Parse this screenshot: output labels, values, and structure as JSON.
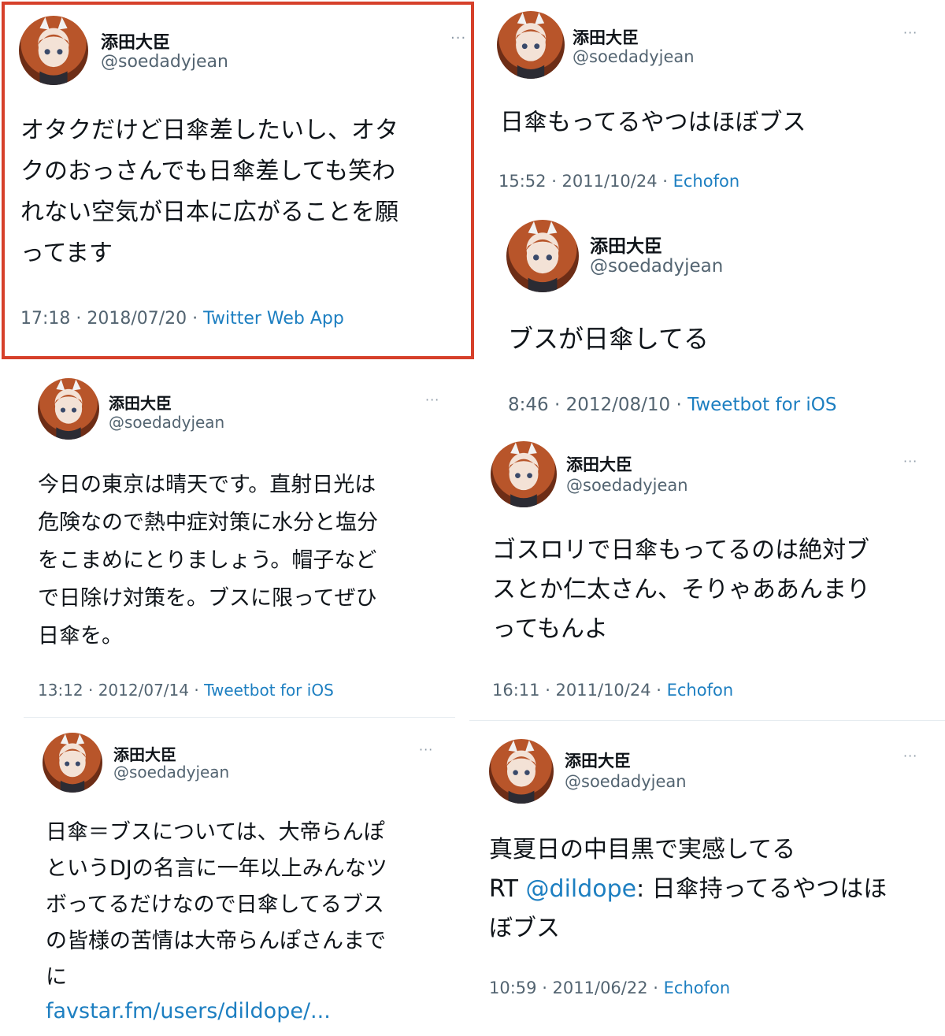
{
  "colors": {
    "highlight_border": "#d6402a",
    "link": "#1d7fc1",
    "muted": "#536471"
  },
  "tweets": [
    {
      "name": "添田大臣",
      "handle": "@soedadyjean",
      "text": "オタクだけど日傘差したいし、オタ\nクのおっさんでも日傘差しても笑わ\nれない空気が日本に広がることを願\nってます",
      "time": "17:18 · 2018/07/20 · ",
      "source": "Twitter Web App",
      "more": "···"
    },
    {
      "name": "添田大臣",
      "handle": "@soedadyjean",
      "text": "今日の東京は晴天です。直射日光は\n危険なので熱中症対策に水分と塩分\nをこまめにとりましょう。帽子など\nで日除け対策を。ブスに限ってぜひ\n日傘を。",
      "time": "13:12 · 2012/07/14 · ",
      "source": "Tweetbot for iOS",
      "more": "···"
    },
    {
      "name": "添田大臣",
      "handle": "@soedadyjean",
      "text": "日傘＝ブスについては、大帝らんぽ\nというDJの名言に一年以上みんなツ\nボってるだけなので日傘してるブス\nの皆様の苦情は大帝らんぽさんまで\nに",
      "link": "favstar.fm/users/dildope/...",
      "more": "···"
    },
    {
      "name": "添田大臣",
      "handle": "@soedadyjean",
      "text": "日傘もってるやつはほぼブス",
      "time": "15:52 · 2011/10/24 · ",
      "source": "Echofon",
      "more": "···"
    },
    {
      "name": "添田大臣",
      "handle": "@soedadyjean",
      "text": "ブスが日傘してる",
      "time": "8:46 · 2012/08/10 · ",
      "source": "Tweetbot for iOS"
    },
    {
      "name": "添田大臣",
      "handle": "@soedadyjean",
      "text": "ゴスロリで日傘もってるのは絶対ブ\nスとか仁太さん、そりゃああんまり\nってもんよ",
      "time": "16:11 · 2011/10/24 · ",
      "source": "Echofon",
      "more": "···"
    },
    {
      "name": "添田大臣",
      "handle": "@soedadyjean",
      "text_line1": "真夏日の中目黒で実感してる",
      "text_rt": "RT ",
      "text_mention": "@dildope",
      "text_rest": ": 日傘持ってるやつはほ",
      "text_line3": "ぼブス",
      "time": "10:59 · 2011/06/22 · ",
      "source": "Echofon",
      "more": "···"
    }
  ]
}
